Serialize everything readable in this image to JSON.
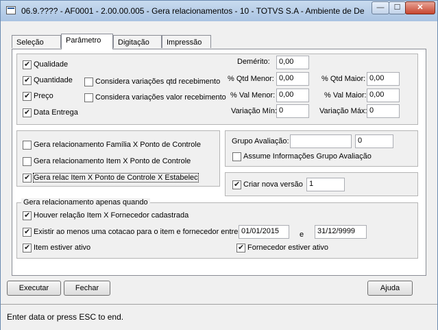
{
  "window": {
    "title": "06.9.???? - AF0001 - 2.00.00.005 - Gera relacionamentos - 10 - TOTVS S.A - Ambiente de De...",
    "min_label": "—",
    "max_label": "☐",
    "close_label": "✕"
  },
  "tabs": [
    {
      "label": "Seleção"
    },
    {
      "label": "Parâmetro"
    },
    {
      "label": "Digitação"
    },
    {
      "label": "Impressão"
    }
  ],
  "criteria": {
    "qualidade": {
      "label": "Qualidade",
      "checked": true
    },
    "quantidade": {
      "label": "Quantidade",
      "checked": true
    },
    "preco": {
      "label": "Preço",
      "checked": true
    },
    "data_entrega": {
      "label": "Data Entrega",
      "checked": true
    },
    "considera_qtd": {
      "label": "Considera variações qtd recebimento",
      "checked": false
    },
    "considera_valor": {
      "label": "Considera variações valor recebimento",
      "checked": false
    },
    "demerito": {
      "label": "Demérito:",
      "value": "0,00"
    },
    "qtd_menor": {
      "label": "% Qtd Menor:",
      "value": "0,00"
    },
    "qtd_maior": {
      "label": "% Qtd Maior:",
      "value": "0,00"
    },
    "val_menor": {
      "label": "% Val Menor:",
      "value": "0,00"
    },
    "val_maior": {
      "label": "% Val Maior:",
      "value": "0,00"
    },
    "variacao_min": {
      "label": "Variação Mín:",
      "value": "0"
    },
    "variacao_max": {
      "label": "Variação Máx:",
      "value": "0"
    }
  },
  "relacionamentos": {
    "familia": {
      "label": "Gera relacionamento Família X Ponto de Controle",
      "checked": false
    },
    "item": {
      "label": "Gera relacionamento Item X  Ponto de Controle",
      "checked": false
    },
    "estabelec": {
      "label": "Gera relac Item X  Ponto de Controle X Estabelec",
      "checked": true
    }
  },
  "grupo": {
    "label": "Grupo Avaliação:",
    "value1": "",
    "value2": "0",
    "assume": {
      "label": "Assume Informações Grupo Avaliação",
      "checked": false
    }
  },
  "versao": {
    "label": "Criar nova versão",
    "checked": true,
    "value": "1"
  },
  "apenas": {
    "title": "Gera relacionamento apenas quando",
    "relacao": {
      "label": "Houver relação Item X Fornecedor cadastrada",
      "checked": true
    },
    "cotacao": {
      "label": "Existir ao menos uma cotacao para o item e fornecedor entre",
      "checked": true
    },
    "date_from": "01/01/2015",
    "date_sep": "e",
    "date_to": "31/12/9999",
    "item_ativo": {
      "label": "Item estiver ativo",
      "checked": true
    },
    "fornecedor_ativo": {
      "label": "Fornecedor estiver ativo",
      "checked": true
    }
  },
  "buttons": {
    "executar": "Executar",
    "fechar": "Fechar",
    "ajuda": "Ajuda"
  },
  "status": "Enter data or press ESC to end."
}
